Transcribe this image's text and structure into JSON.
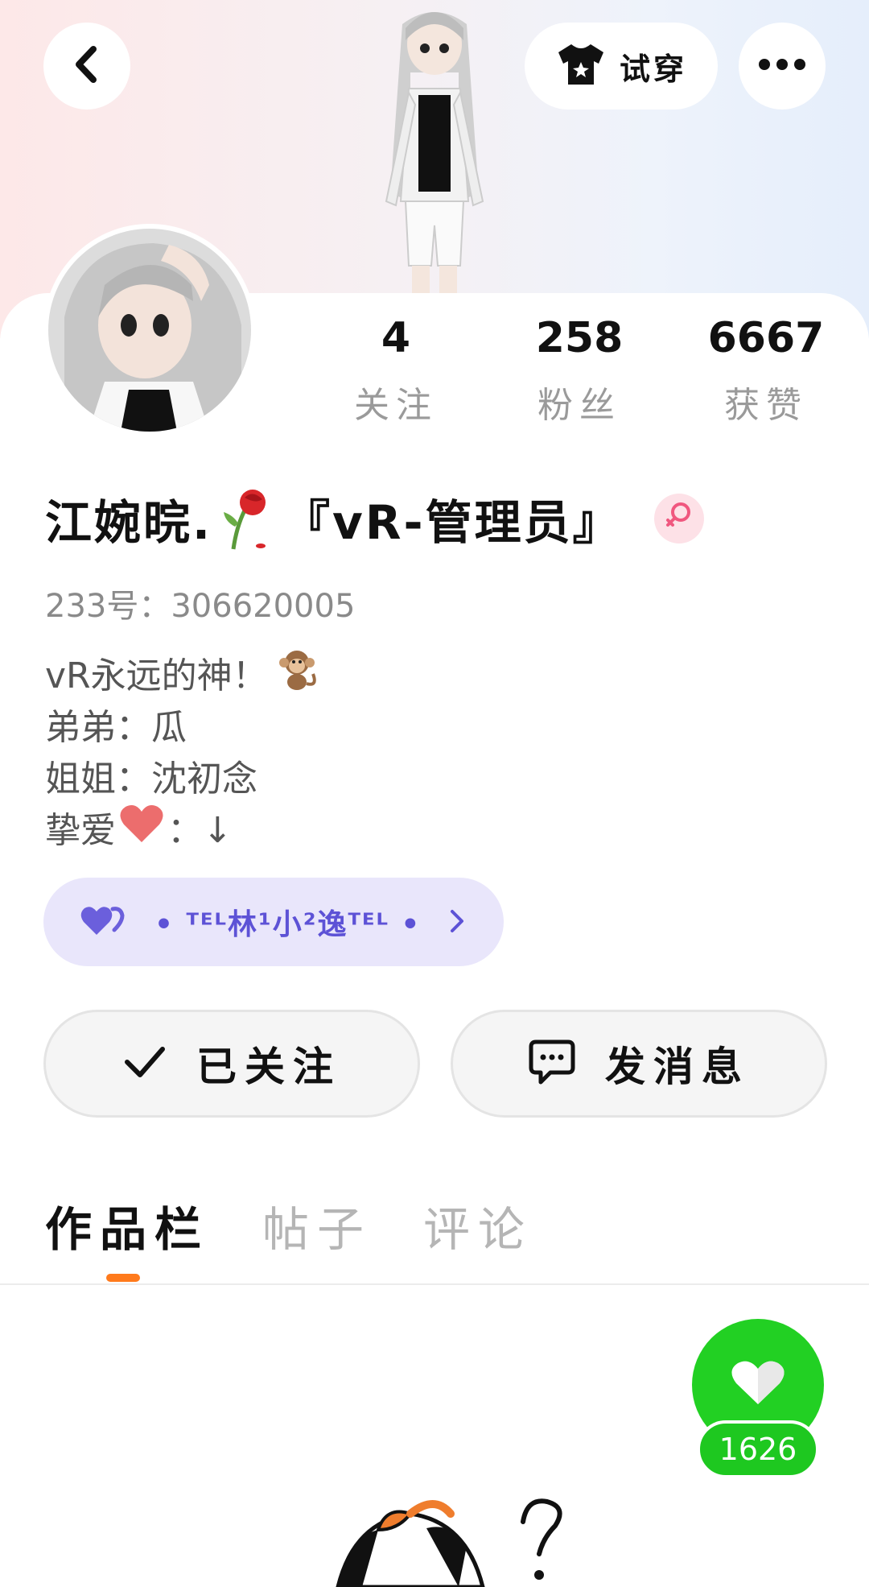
{
  "header": {
    "tryon_label": "试穿"
  },
  "stats": [
    {
      "value": "4",
      "label": "关注"
    },
    {
      "value": "258",
      "label": "粉丝"
    },
    {
      "value": "6667",
      "label": "获赞"
    }
  ],
  "profile": {
    "nickname": "江婉晥.",
    "nickname_suffix": "『vR-管理员』",
    "gender": "female",
    "uid_label": "233号：",
    "uid_value": "306620005"
  },
  "bio": {
    "line1": "vR永远的神！",
    "line2": "弟弟：瓜",
    "line3": "姐姐：沈初念",
    "line4_prefix": "挚爱",
    "line4_suffix": "：↓"
  },
  "couple": {
    "name": "• ᵀᴱᴸ林¹小²逸ᵀᴱᴸ •"
  },
  "actions": {
    "follow_label": "已关注",
    "message_label": "发消息"
  },
  "tabs": [
    {
      "label": "作品栏",
      "active": true
    },
    {
      "label": "帖子",
      "active": false
    },
    {
      "label": "评论",
      "active": false
    }
  ],
  "like_fab": {
    "count": "1626"
  },
  "colors": {
    "accent_orange": "#ff7a1c",
    "like_green": "#22d023",
    "couple_purple": "#5d52d6",
    "couple_pill_bg": "#e9e6fb"
  }
}
